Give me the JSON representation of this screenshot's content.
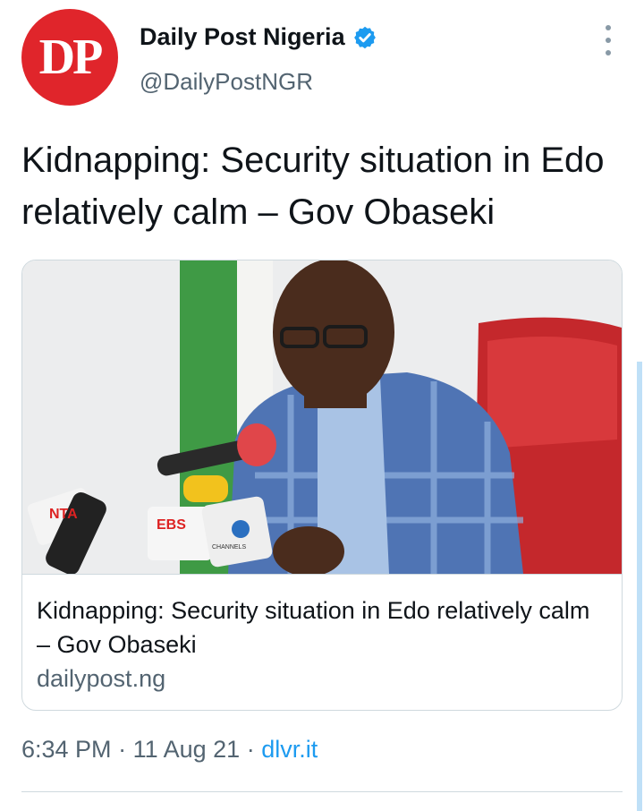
{
  "author": {
    "avatar_text": "DP",
    "name": "Daily Post Nigeria",
    "handle": "@DailyPostNGR",
    "verified": true
  },
  "tweet": {
    "text": "Kidnapping: Security situation in Edo relatively calm – Gov Obaseki"
  },
  "card": {
    "title": "Kidnapping: Security situation in Edo relatively calm – Gov Obaseki",
    "domain": "dailypost.ng",
    "image_mic_labels": [
      "NTA",
      "EBS",
      "CHANNELS"
    ]
  },
  "meta": {
    "time": "6:34 PM",
    "separator": " · ",
    "date": "11 Aug 21",
    "source": "dlvr.it"
  },
  "colors": {
    "accent": "#1d9bf0",
    "brand": "#e0252b",
    "secondary_text": "#536471"
  },
  "icons": {
    "verified": "verified-badge-icon",
    "more": "more-options-icon"
  }
}
